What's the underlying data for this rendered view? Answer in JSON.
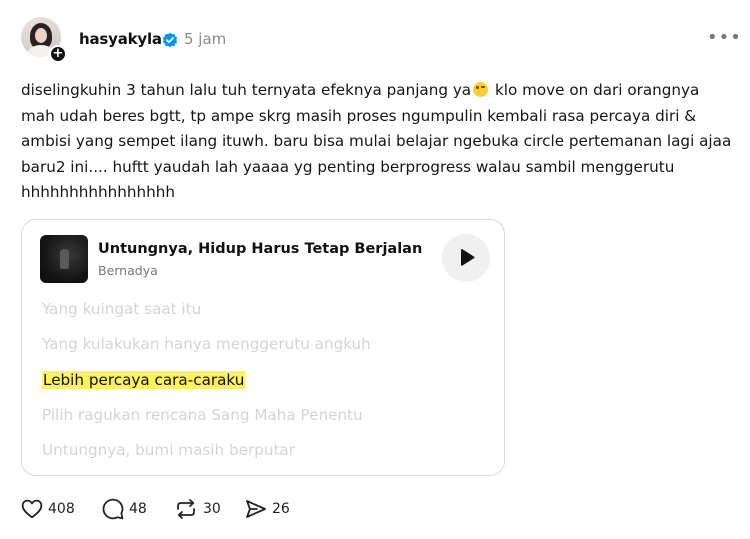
{
  "post": {
    "author": {
      "username": "hasyakyla",
      "time": "5 jam"
    },
    "text_before_emoji": "diselingkuhin 3 tahun lalu tuh ternyata efeknya panjang ya",
    "emoji": "upside-down-face-emoji",
    "text_after_emoji": " klo move on dari orangnya mah udah beres bgtt, tp ampe skrg masih proses ngumpulin kembali rasa percaya diri & ambisi yang sempet ilang ituwh. baru bisa mulai belajar ngebuka circle pertemanan lagi ajaa baru2 ini.... huftt yaudah lah yaaaa yg penting berprogress walau sambil menggerutu hhhhhhhhhhhhhhhh"
  },
  "music_card": {
    "song_title": "Untungnya, Hidup Harus Tetap Berjalan",
    "artist": "Bernadya",
    "lyrics": [
      "Yang kuingat saat itu",
      "Yang kulakukan hanya menggerutu angkuh",
      "Lebih percaya cara-caraku",
      "Pilih ragukan rencana Sang Maha Penentu",
      "Untungnya, bumi masih berputar"
    ],
    "active_lyric_index": 2,
    "highlight_color": "#fbf35a"
  },
  "actions": {
    "likes": "408",
    "replies": "48",
    "reposts": "30",
    "shares": "26"
  },
  "colors": {
    "verified_badge": "#0095f6",
    "muted_text": "#8a8a8a",
    "inactive_lyric": "#d4d4d4"
  }
}
